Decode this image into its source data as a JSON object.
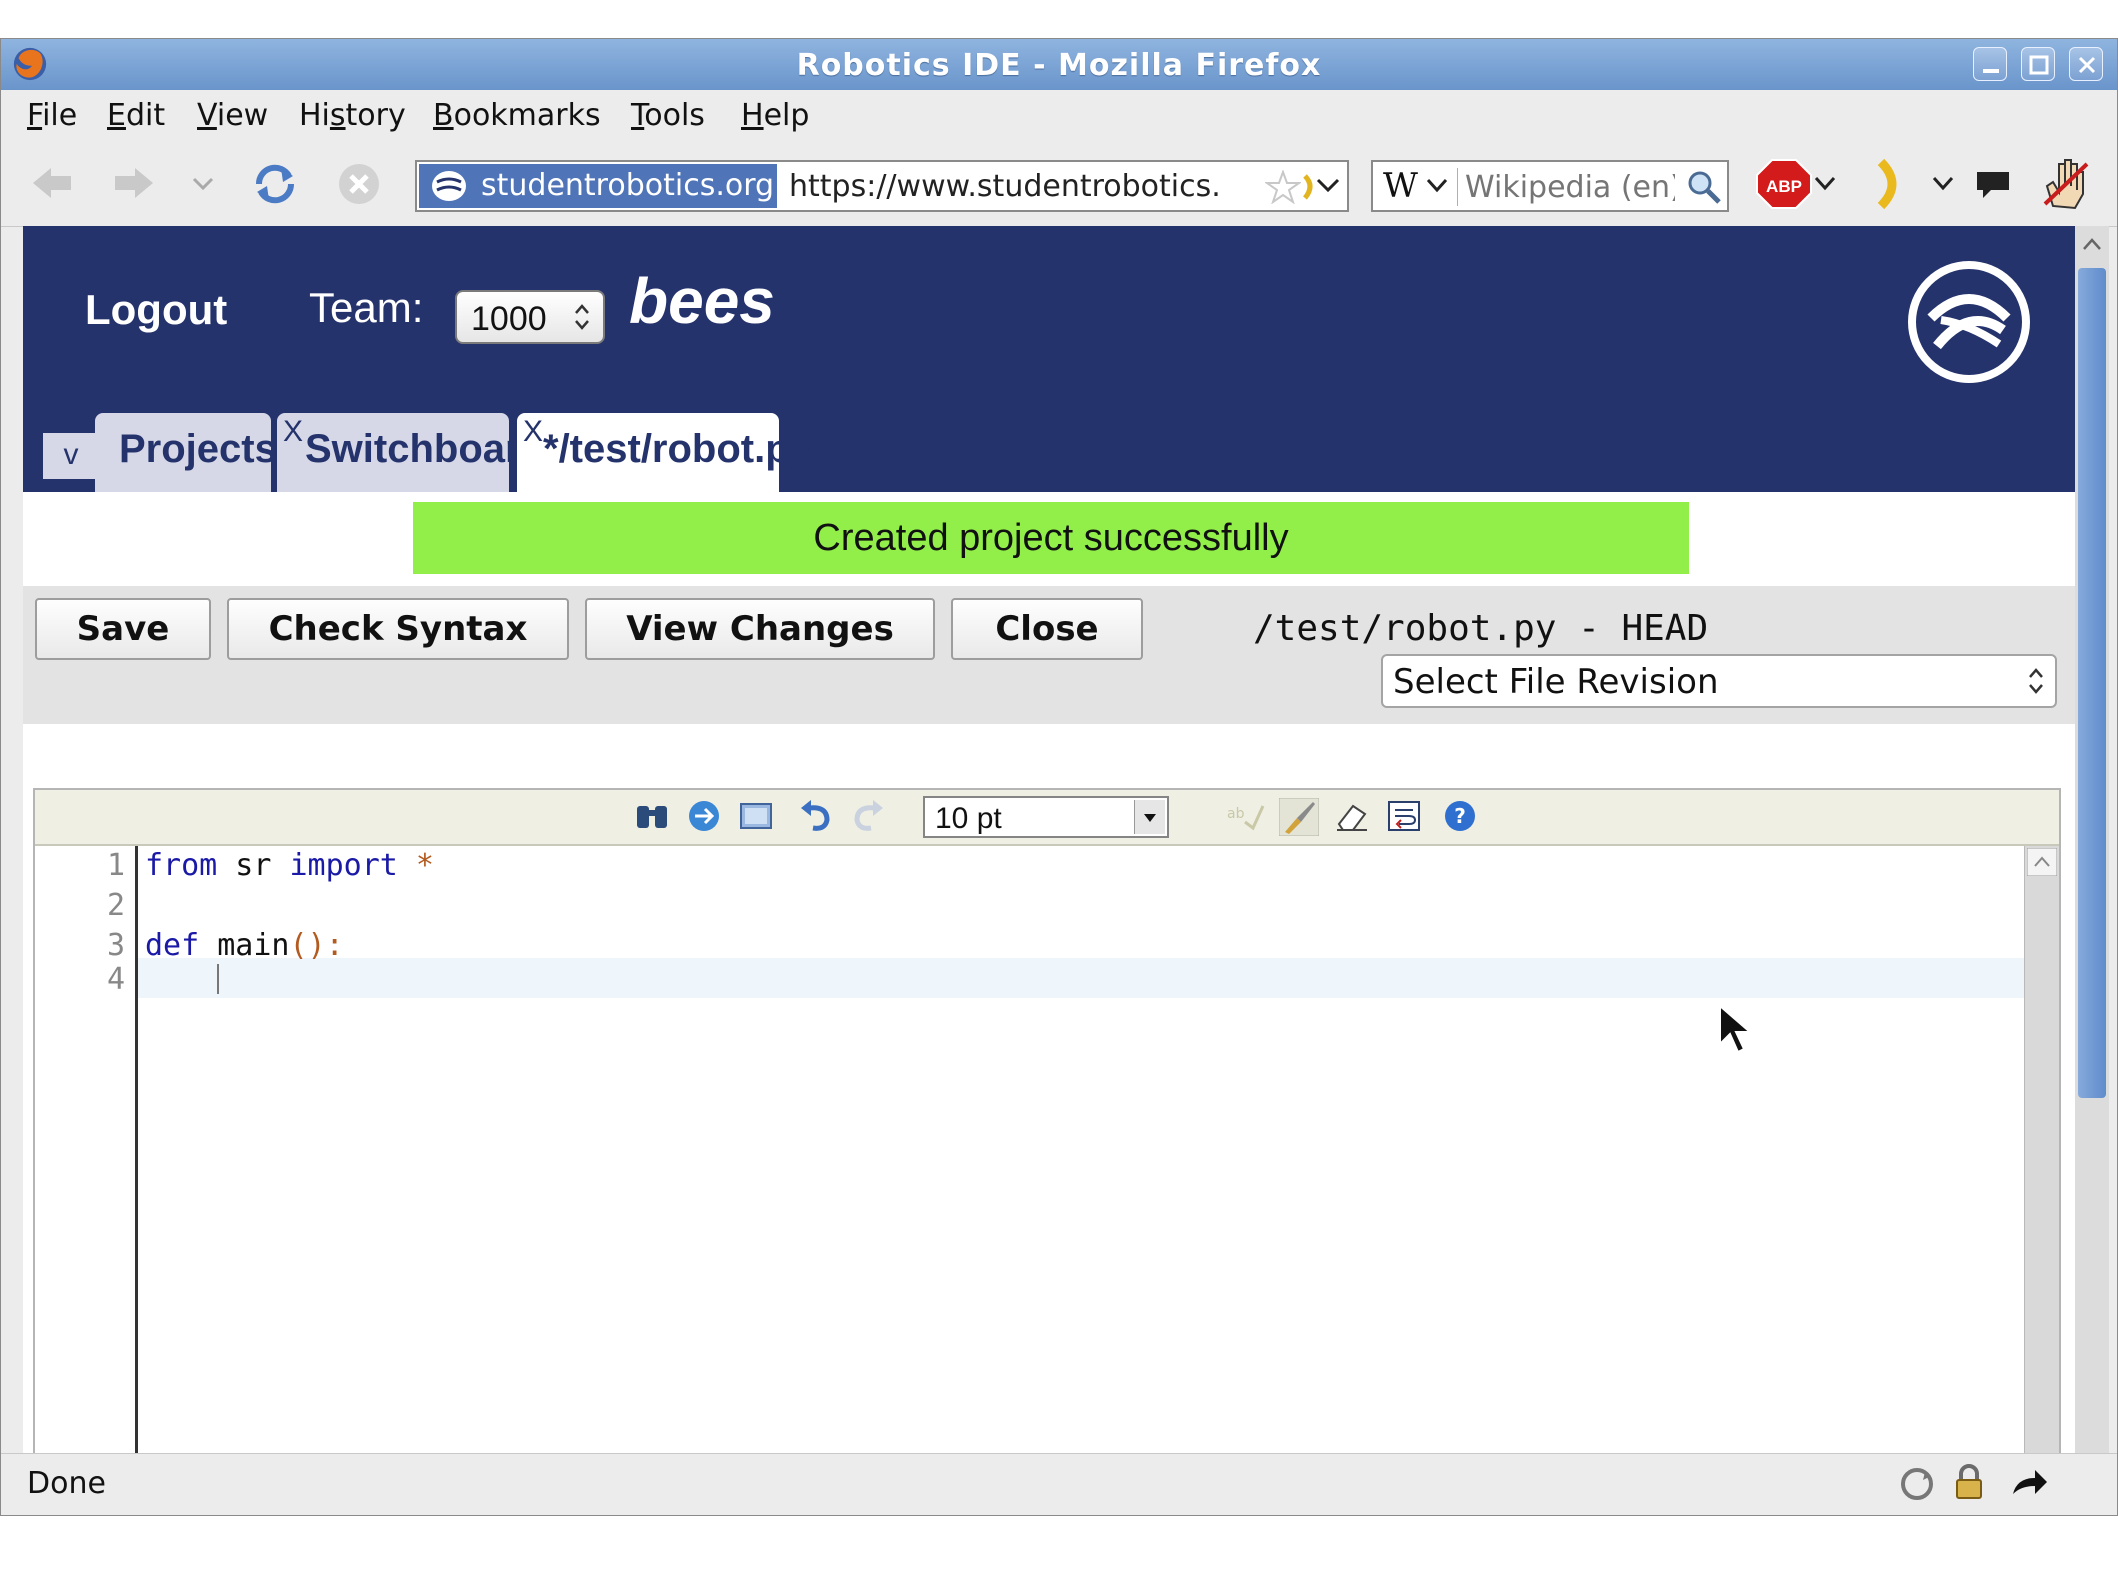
{
  "window": {
    "title": "Robotics IDE - Mozilla Firefox"
  },
  "menu": [
    {
      "label": "File",
      "u": "F",
      "rest": "ile"
    },
    {
      "label": "Edit",
      "u": "E",
      "rest": "dit"
    },
    {
      "label": "View",
      "u": "V",
      "rest": "iew"
    },
    {
      "label": "History",
      "pre": "Hi",
      "u": "s",
      "rest": "tory"
    },
    {
      "label": "Bookmarks",
      "u": "B",
      "rest": "ookmarks"
    },
    {
      "label": "Tools",
      "u": "T",
      "rest": "ools"
    },
    {
      "label": "Help",
      "u": "H",
      "rest": "elp"
    }
  ],
  "nav": {
    "site_identity": "studentrobotics.org",
    "url": "https://www.studentrobotics.",
    "search_engine": "W",
    "search_placeholder": "Wikipedia (en)"
  },
  "header": {
    "logout": "Logout",
    "team_label": "Team:",
    "team_value": "1000",
    "team_name": "bees"
  },
  "tabs": {
    "toggle": "v",
    "projects": "Projects",
    "switchboard_close": "X",
    "switchboard": "Switchboard",
    "file_close": "X",
    "file": "*/test/robot.py"
  },
  "status_message": "Created project successfully",
  "editor_toolbar": {
    "save": "Save",
    "check_syntax": "Check Syntax",
    "view_changes": "View Changes",
    "close": "Close",
    "file_path": "/test/robot.py - HEAD",
    "revision_select": "Select File Revision"
  },
  "editor": {
    "font_size": "10 pt",
    "lines": [
      {
        "n": "1",
        "tokens": [
          {
            "t": "from",
            "c": "kw"
          },
          {
            "t": " sr ",
            "c": ""
          },
          {
            "t": "import",
            "c": "kw"
          },
          {
            "t": " *",
            "c": "pn"
          }
        ]
      },
      {
        "n": "2",
        "tokens": []
      },
      {
        "n": "3",
        "tokens": [
          {
            "t": "def",
            "c": "kw"
          },
          {
            "t": " main",
            "c": ""
          },
          {
            "t": "():",
            "c": "pn"
          }
        ]
      },
      {
        "n": "4",
        "tokens": []
      }
    ]
  },
  "status_bar": {
    "text": "Done"
  },
  "colors": {
    "header_bg": "#25336c",
    "status_success": "#92ef4a"
  }
}
